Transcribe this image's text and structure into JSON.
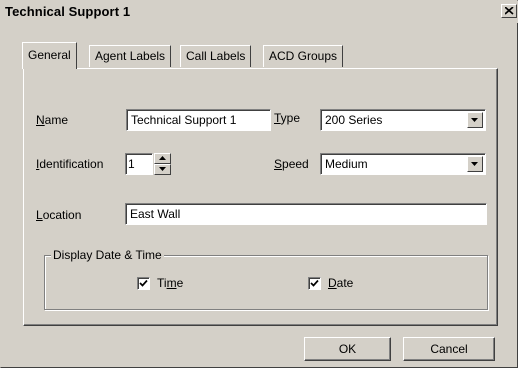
{
  "window": {
    "title": "Technical Support 1"
  },
  "tabs": [
    {
      "label": "General"
    },
    {
      "label": "Agent Labels"
    },
    {
      "label": "Call Labels"
    },
    {
      "label": "ACD Groups"
    }
  ],
  "general": {
    "name_label": {
      "mnemonic": "N",
      "rest": "ame"
    },
    "name_value": "Technical Support 1",
    "type_label": {
      "mnemonic": "T",
      "rest": "ype"
    },
    "type_value": "200 Series",
    "identification_label": {
      "mnemonic": "I",
      "rest": "dentification"
    },
    "identification_value": "1",
    "speed_label": {
      "mnemonic": "S",
      "rest": "peed"
    },
    "speed_value": "Medium",
    "location_label": {
      "mnemonic": "L",
      "rest": "ocation"
    },
    "location_value": "East Wall",
    "display_group": {
      "legend": "Display Date & Time",
      "time": {
        "before": "Ti",
        "mnemonic": "m",
        "after": "e",
        "checked": true
      },
      "date": {
        "mnemonic": "D",
        "rest": "ate",
        "checked": true
      }
    }
  },
  "buttons": {
    "ok": "OK",
    "cancel": "Cancel"
  },
  "icons": {
    "close": "close-icon",
    "dropdown": "chevron-down-icon",
    "spin_up": "spin-up-icon",
    "spin_down": "spin-down-icon",
    "check": "check-icon"
  }
}
